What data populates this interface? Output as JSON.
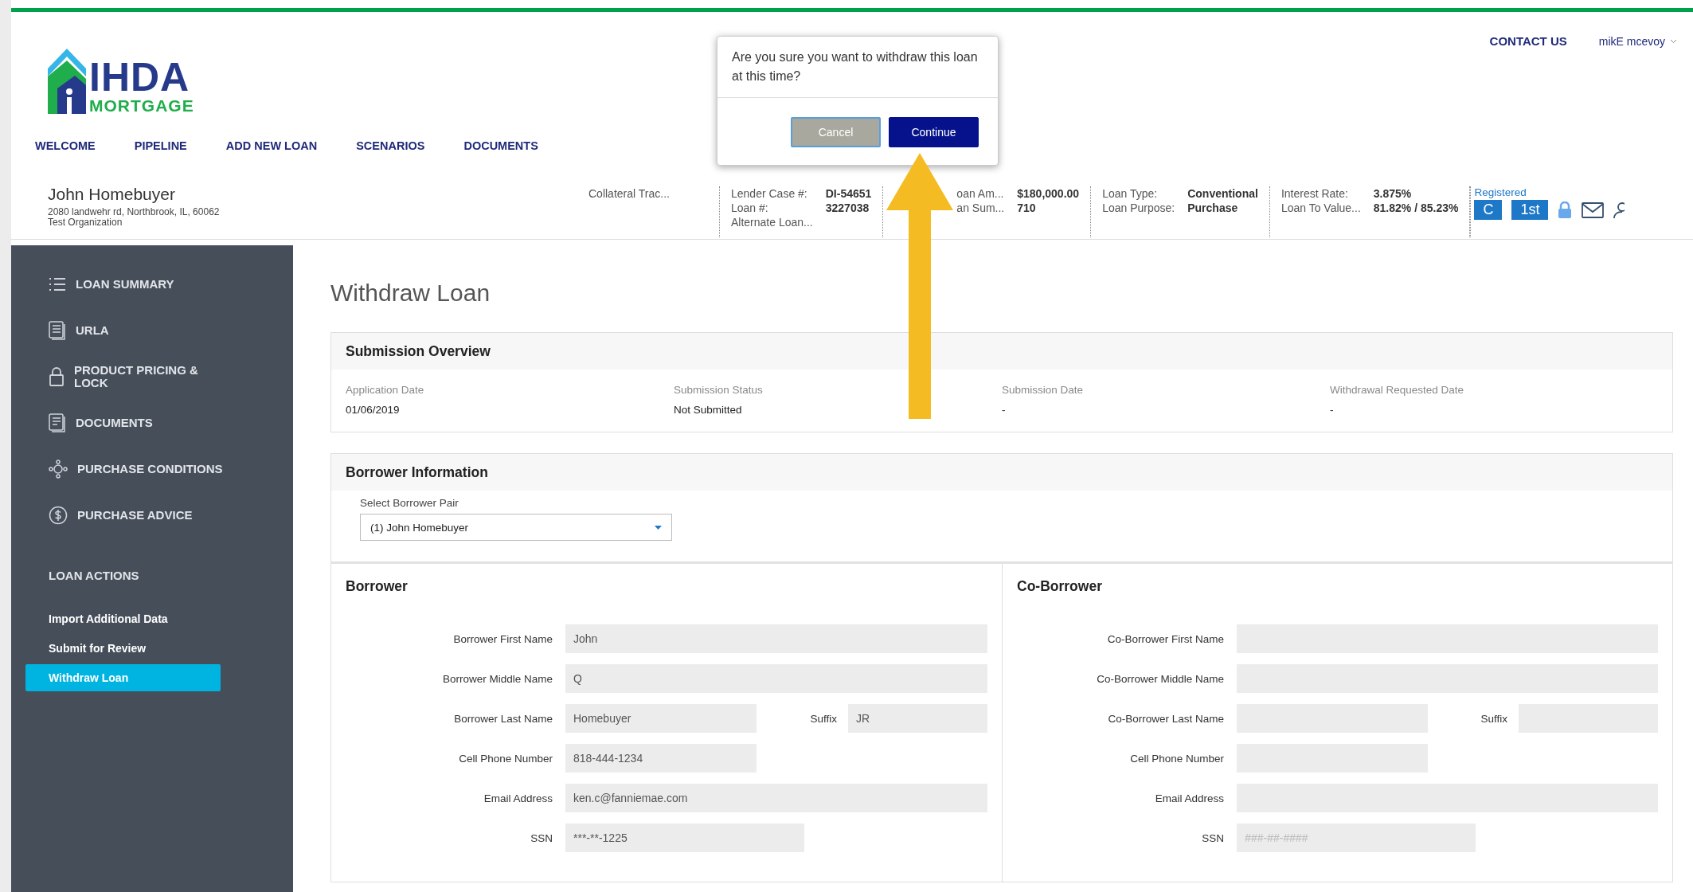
{
  "logo": {
    "name": "IHDA",
    "tagline": "MORTGAGE"
  },
  "top_links": {
    "contact": "CONTACT US",
    "user": "mikE mcevoy"
  },
  "nav": [
    {
      "label": "WELCOME"
    },
    {
      "label": "PIPELINE"
    },
    {
      "label": "ADD NEW LOAN"
    },
    {
      "label": "SCENARIOS"
    },
    {
      "label": "DOCUMENTS"
    }
  ],
  "borrower_header": {
    "name": "John Homebuyer",
    "address": "2080 landwehr rd, Northbrook, IL, 60062",
    "organization": "Test Organization"
  },
  "loan_info": [
    {
      "rows": [
        {
          "label": "Collateral Trac..."
        }
      ]
    },
    {
      "rows": [
        {
          "label": "Lender Case #:",
          "value": "DI-54651"
        },
        {
          "label": "Loan #:",
          "value": "3227038"
        },
        {
          "label": "Alternate Loan..."
        }
      ]
    },
    {
      "rows": [
        {
          "label": "oan Am...",
          "value": "$180,000.00"
        },
        {
          "label": "an Sum...",
          "value": "710"
        }
      ]
    },
    {
      "rows": [
        {
          "label": "Loan Type:",
          "value": "Conventional"
        },
        {
          "label": "Loan Purpose:",
          "value": "Purchase"
        }
      ]
    },
    {
      "rows": [
        {
          "label": "Interest Rate:",
          "value": "3.875%"
        },
        {
          "label": "Loan To Value...",
          "value": "81.82% / 85.23%"
        }
      ]
    }
  ],
  "status": {
    "label": "Registered",
    "badges": [
      "C",
      "1st"
    ]
  },
  "sidebar": {
    "items": [
      {
        "label": "LOAN SUMMARY"
      },
      {
        "label": "URLA"
      },
      {
        "label": "PRODUCT PRICING & LOCK"
      },
      {
        "label": "DOCUMENTS"
      },
      {
        "label": "PURCHASE CONDITIONS"
      },
      {
        "label": "PURCHASE ADVICE"
      }
    ],
    "actions_title": "LOAN ACTIONS",
    "actions": [
      {
        "label": "Import Additional Data",
        "selected": false
      },
      {
        "label": "Submit for Review",
        "selected": false
      },
      {
        "label": "Withdraw Loan",
        "selected": true
      }
    ]
  },
  "page_title": "Withdraw Loan",
  "submission_overview": {
    "title": "Submission Overview",
    "fields": [
      {
        "label": "Application Date",
        "value": "01/06/2019"
      },
      {
        "label": "Submission Status",
        "value": "Not Submitted"
      },
      {
        "label": "Submission Date",
        "value": "-"
      },
      {
        "label": "Withdrawal Requested Date",
        "value": "-"
      }
    ]
  },
  "borrower_information": {
    "title": "Borrower Information",
    "select_label": "Select Borrower Pair",
    "select_value": "(1) John Homebuyer"
  },
  "borrowers": [
    {
      "title": "Borrower",
      "fields": [
        {
          "kind": "full",
          "label": "Borrower First Name",
          "value": "John"
        },
        {
          "kind": "full",
          "label": "Borrower Middle Name",
          "value": "Q"
        },
        {
          "kind": "name_suffix",
          "label": "Borrower Last Name",
          "value": "Homebuyer",
          "suffix_label": "Suffix",
          "suffix_value": "JR"
        },
        {
          "kind": "short",
          "label": "Cell Phone Number",
          "value": "818-444-1234"
        },
        {
          "kind": "full",
          "label": "Email Address",
          "value": "ken.c@fanniemae.com"
        },
        {
          "kind": "ssn",
          "label": "SSN",
          "value": "***-**-1225"
        }
      ]
    },
    {
      "title": "Co-Borrower",
      "fields": [
        {
          "kind": "full",
          "label": "Co-Borrower First Name"
        },
        {
          "kind": "full",
          "label": "Co-Borrower Middle Name"
        },
        {
          "kind": "name_suffix",
          "label": "Co-Borrower Last Name",
          "suffix_label": "Suffix"
        },
        {
          "kind": "short",
          "label": "Cell Phone Number"
        },
        {
          "kind": "full",
          "label": "Email Address"
        },
        {
          "kind": "ssn",
          "label": "SSN",
          "placeholder": "###-##-####"
        }
      ]
    }
  ],
  "dialog": {
    "message": "Are you sure you want to withdraw this loan at this time?",
    "buttons": [
      {
        "label": "Cancel",
        "kind": "secondary"
      },
      {
        "label": "Continue",
        "kind": "primary"
      }
    ]
  }
}
